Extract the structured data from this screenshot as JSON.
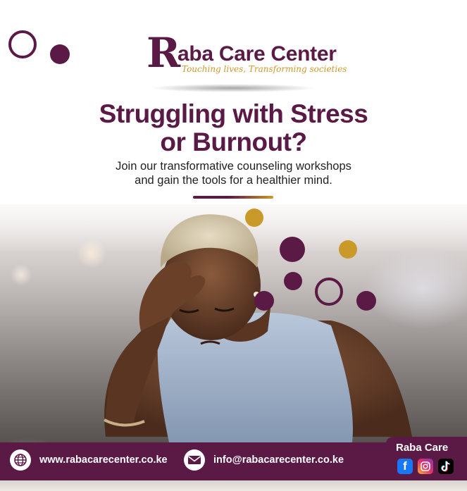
{
  "brand": {
    "logo_letter": "R",
    "name": "aba Care Center",
    "tagline": "Touching lives, Transforming societies"
  },
  "headline": {
    "line1": "Struggling with Stress",
    "line2": "or Burnout?"
  },
  "subtext": {
    "line1": "Join our transformative counseling workshops",
    "line2": "and gain the tools for a healthier mind."
  },
  "footer": {
    "website": "www.rabacarecenter.co.ke",
    "email": "info@rabacarecenter.co.ke",
    "brand_label": "Raba Care"
  },
  "icons": {
    "website": "globe-icon",
    "email": "envelope-icon",
    "socials": [
      "facebook-icon",
      "instagram-icon",
      "tiktok-icon"
    ]
  },
  "colors": {
    "primary": "#5b1a45",
    "accent": "#c99a2a",
    "text": "#222222",
    "footer_text": "#ffffff"
  }
}
